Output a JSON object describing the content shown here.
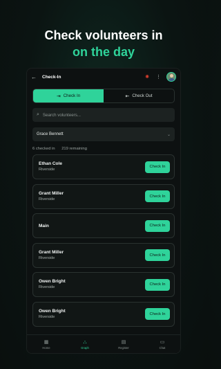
{
  "headline": {
    "line1": "Check volunteers in",
    "line2": "on the day"
  },
  "appbar": {
    "title": "Check-In"
  },
  "segments": {
    "check_in": "Check In",
    "check_out": "Check Out"
  },
  "search": {
    "placeholder": "Search volunteers..."
  },
  "selector": {
    "value": "Grace Bennett"
  },
  "counts": {
    "checked_in": "6 checked in",
    "remaining": "219 remaining"
  },
  "volunteers": [
    {
      "name": "Ethan Cole",
      "location": "Riverside",
      "action": "Check In"
    },
    {
      "name": "Grant Miller",
      "location": "Riverside",
      "action": "Check In"
    },
    {
      "name": "Main",
      "location": "",
      "action": "Check In"
    },
    {
      "name": "Grant Miller",
      "location": "Riverside",
      "action": "Check In"
    },
    {
      "name": "Owen Bright",
      "location": "Riverside",
      "action": "Check In"
    },
    {
      "name": "Owen Bright",
      "location": "Riverside",
      "action": "Check In"
    }
  ],
  "tabs": [
    {
      "label": "Home",
      "icon": "grid-icon"
    },
    {
      "label": "Graph",
      "icon": "graph-icon"
    },
    {
      "label": "Register",
      "icon": "clipboard-icon"
    },
    {
      "label": "Chat",
      "icon": "chat-icon"
    }
  ],
  "colors": {
    "accent": "#2fd39a",
    "background": "#0b1412",
    "card": "#111615"
  }
}
